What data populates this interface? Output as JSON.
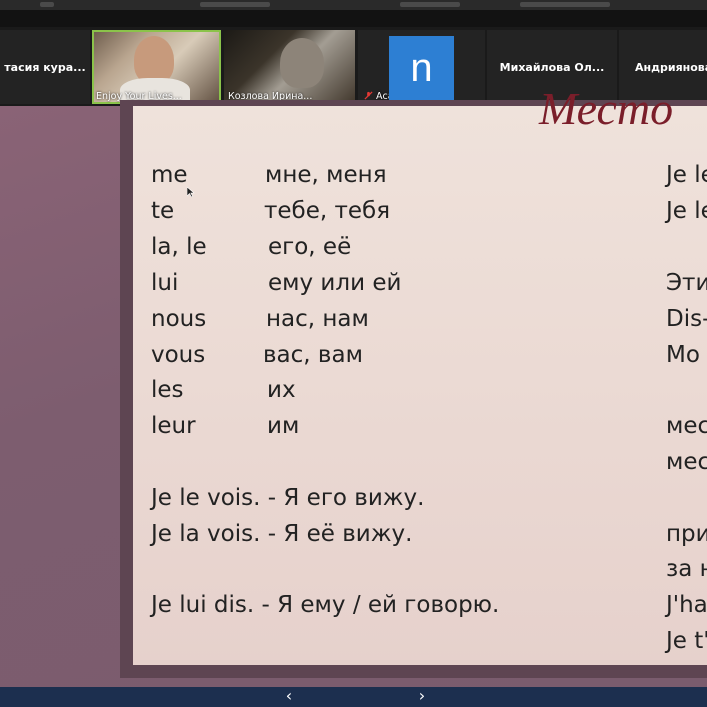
{
  "participants": [
    {
      "name": "тасия кура..."
    },
    {
      "name": "Enjoy Your Lives..."
    },
    {
      "name": "Козлова Ирина..."
    },
    {
      "name": "Асанова Нат...",
      "avatar_letter": "n",
      "muted": true
    },
    {
      "name": "Михайлова Ол..."
    },
    {
      "name": "Андриянова"
    }
  ],
  "slide": {
    "title": "Место",
    "pronouns": [
      {
        "fr": "me",
        "ru": "мне, меня"
      },
      {
        "fr": "te",
        "ru": "тебе, тебя"
      },
      {
        "fr": "la, le",
        "ru": "его, её"
      },
      {
        "fr": "lui",
        "ru": "ему или ей"
      },
      {
        "fr": "nous",
        "ru": "нас, нам"
      },
      {
        "fr": "vous",
        "ru": "вас, вам"
      },
      {
        "fr": "les",
        "ru": "их"
      },
      {
        "fr": "leur",
        "ru": "им"
      }
    ],
    "examples": [
      "Je le vois. - Я его вижу.",
      "Je la vois. - Я её вижу.",
      "Je lui dis. - Я ему / ей говорю."
    ],
    "right_column": [
      "Je le",
      "Je le",
      "Эти",
      "Dis-",
      "Mo",
      "мес",
      "мес",
      "при",
      "за н",
      "J'ha",
      "Je t'"
    ]
  },
  "nav": {
    "prev": "‹",
    "next": "›"
  },
  "colors": {
    "accent_active": "#8bc34a",
    "avatar_bg": "#2d7fd3",
    "title": "#7a1e2a",
    "bottom_bar": "#1c2f4f"
  }
}
